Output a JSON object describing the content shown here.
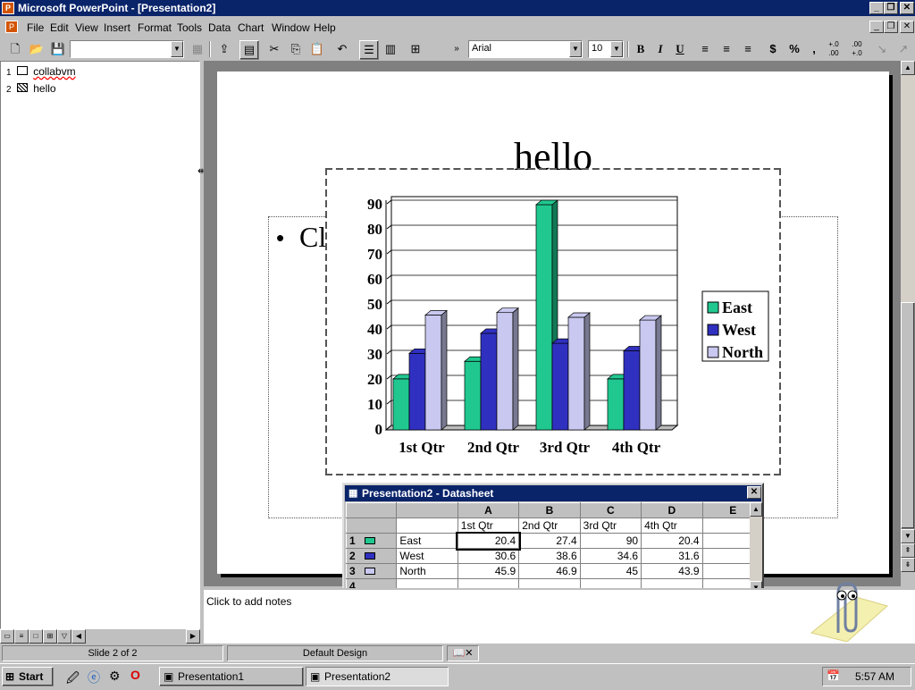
{
  "window": {
    "title": "Microsoft PowerPoint - [Presentation2]"
  },
  "menu": {
    "items": [
      "File",
      "Edit",
      "View",
      "Insert",
      "Format",
      "Tools",
      "Data",
      "Chart",
      "Window",
      "Help"
    ]
  },
  "toolbar": {
    "font": "Arial",
    "size": "10",
    "bold": "B",
    "italic": "I",
    "underline": "U",
    "currency": "$",
    "percent": "%",
    "comma": ",",
    "inc_dec": "+.0 .00",
    "dec_dec": ".00 +.0"
  },
  "outline": {
    "items": [
      {
        "num": "1",
        "label": "collabvm"
      },
      {
        "num": "2",
        "label": "hello"
      }
    ]
  },
  "slide": {
    "title": "hello",
    "bullet_char": "•",
    "bullet_text": "Cl"
  },
  "notes": {
    "placeholder": "Click to add notes"
  },
  "status": {
    "slide": "Slide 2 of 2",
    "design": "Default Design"
  },
  "taskbar": {
    "start": "Start",
    "tasks": [
      "Presentation1",
      "Presentation2"
    ],
    "time": "5:57 AM"
  },
  "datasheet": {
    "title": "Presentation2 - Datasheet",
    "columns": [
      "A",
      "B",
      "C",
      "D",
      "E"
    ],
    "header_row": [
      "1st Qtr",
      "2nd Qtr",
      "3rd Qtr",
      "4th Qtr",
      ""
    ],
    "rows": [
      {
        "num": "1",
        "name": "East",
        "values": [
          "20.4",
          "27.4",
          "90",
          "20.4",
          ""
        ]
      },
      {
        "num": "2",
        "name": "West",
        "values": [
          "30.6",
          "38.6",
          "34.6",
          "31.6",
          ""
        ]
      },
      {
        "num": "3",
        "name": "North",
        "values": [
          "45.9",
          "46.9",
          "45",
          "43.9",
          ""
        ]
      },
      {
        "num": "4",
        "name": "",
        "values": [
          "",
          "",
          "",
          "",
          ""
        ]
      }
    ]
  },
  "chart_data": {
    "type": "bar",
    "categories": [
      "1st Qtr",
      "2nd Qtr",
      "3rd Qtr",
      "4th Qtr"
    ],
    "series": [
      {
        "name": "East",
        "values": [
          20.4,
          27.4,
          90,
          20.4
        ],
        "color": "#20c890"
      },
      {
        "name": "West",
        "values": [
          30.6,
          38.6,
          34.6,
          31.6
        ],
        "color": "#3030c0"
      },
      {
        "name": "North",
        "values": [
          45.9,
          46.9,
          45,
          43.9
        ],
        "color": "#c8c8f0"
      }
    ],
    "ylim": [
      0,
      90
    ],
    "yticks": [
      "0",
      "10",
      "20",
      "30",
      "40",
      "50",
      "60",
      "70",
      "80",
      "90"
    ],
    "grid": true,
    "legend": "right"
  }
}
